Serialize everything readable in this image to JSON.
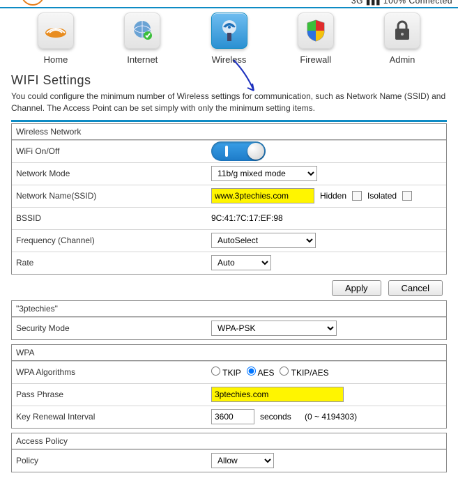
{
  "status": {
    "network_type": "3G",
    "signal": "▮▮▮",
    "percent": "100%",
    "connected": "Connected"
  },
  "nav": {
    "home": "Home",
    "internet": "Internet",
    "wireless": "Wireless",
    "firewall": "Firewall",
    "admin": "Admin"
  },
  "page": {
    "title": "WIFI Settings",
    "desc": "You could configure the minimum number of Wireless settings for communication, such as Network Name (SSID) and Channel. The Access Point can be set simply with only the minimum setting items."
  },
  "wireless_network": {
    "heading": "Wireless Network",
    "wifi_onoff_label": "WiFi On/Off",
    "network_mode_label": "Network Mode",
    "network_mode_value": "11b/g mixed mode",
    "ssid_label": "Network Name(SSID)",
    "ssid_value": "www.3ptechies.com",
    "hidden_label": "Hidden",
    "isolated_label": "Isolated",
    "bssid_label": "BSSID",
    "bssid_value": "9C:41:7C:17:EF:98",
    "frequency_label": "Frequency (Channel)",
    "frequency_value": "AutoSelect",
    "rate_label": "Rate",
    "rate_value": "Auto"
  },
  "buttons": {
    "apply": "Apply",
    "cancel": "Cancel"
  },
  "security": {
    "heading": "\"3ptechies\"",
    "mode_label": "Security Mode",
    "mode_value": "WPA-PSK"
  },
  "wpa": {
    "heading": "WPA",
    "algo_label": "WPA Algorithms",
    "tkip": "TKIP",
    "aes": "AES",
    "tkipaes": "TKIP/AES",
    "pass_label": "Pass Phrase",
    "pass_value": "3ptechies.com",
    "renew_label": "Key Renewal Interval",
    "renew_value": "3600",
    "renew_unit": "seconds",
    "renew_range": "(0 ~ 4194303)"
  },
  "access": {
    "heading": "Access Policy",
    "policy_label": "Policy",
    "policy_value": "Allow"
  }
}
